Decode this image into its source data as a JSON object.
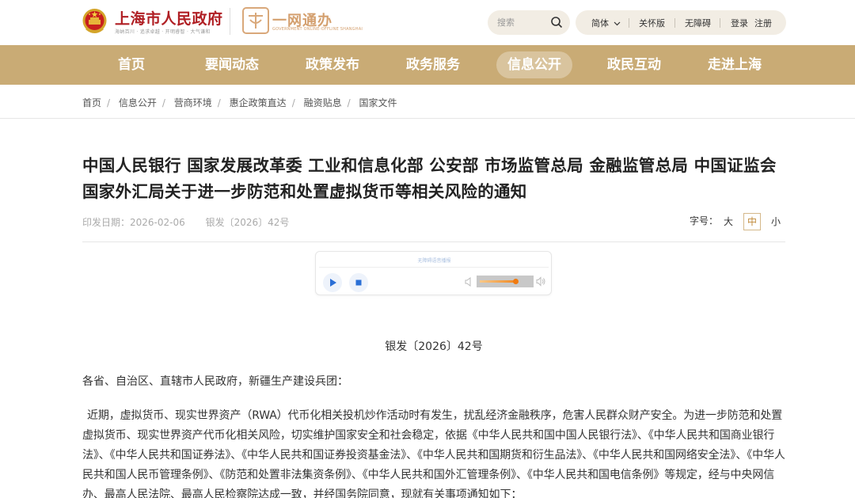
{
  "header": {
    "site_title": "上海市人民政府",
    "site_slogan": "海纳百川 · 追求卓越 · 开明睿智 · 大气谦和",
    "ywtb_title": "一网通办",
    "ywtb_sub": "GOVERNMENT ONLINE-OFFLINE SHANGHAI",
    "search_placeholder": "搜索",
    "utils": {
      "lang": "简体",
      "care": "关怀版",
      "accessible": "无障碍",
      "login": "登录",
      "register": "注册"
    }
  },
  "nav": {
    "items": [
      {
        "label": "首页"
      },
      {
        "label": "要闻动态"
      },
      {
        "label": "政策发布"
      },
      {
        "label": "政务服务"
      },
      {
        "label": "信息公开",
        "active": true
      },
      {
        "label": "政民互动"
      },
      {
        "label": "走进上海"
      }
    ]
  },
  "breadcrumb": [
    "首页",
    "信息公开",
    "营商环境",
    "惠企政策直达",
    "融资贴息",
    "国家文件"
  ],
  "article": {
    "title": "中国人民银行 国家发展改革委 工业和信息化部 公安部 市场监管总局 金融监管总局 中国证监会 国家外汇局关于进一步防范和处置虚拟货币等相关风险的通知",
    "meta": {
      "date_label": "印发日期：",
      "date": "2026-02-06",
      "doc_number": "银发〔2026〕42号"
    },
    "font_size": {
      "label": "字号：",
      "large": "大",
      "medium": "中",
      "small": "小",
      "selected": "中"
    },
    "player": {
      "label": "无障碍语音播报",
      "volume": 0.7
    },
    "body_doc_number": "银发〔2026〕42号",
    "salutation": "各省、自治区、直辖市人民政府，新疆生产建设兵团：",
    "paragraph": "近期，虚拟货币、现实世界资产（RWA）代币化相关投机炒作活动时有发生，扰乱经济金融秩序，危害人民群众财产安全。为进一步防范和处置虚拟货币、现实世界资产代币化相关风险，切实维护国家安全和社会稳定，依据《中华人民共和国中国人民银行法》、《中华人民共和国商业银行法》、《中华人民共和国证券法》、《中华人民共和国证券投资基金法》、《中华人民共和国期货和衍生品法》、《中华人民共和国网络安全法》、《中华人民共和国人民币管理条例》、《防范和处置非法集资条例》、《中华人民共和国外汇管理条例》、《中华人民共和国电信条例》等规定，经与中央网信办、最高人民法院、最高人民检察院达成一致，并经国务院同意，现就有关事项通知如下："
  },
  "colors": {
    "brand_red": "#b01f24",
    "nav_gold": "#c9ab75",
    "accent_orange": "#f08a24"
  }
}
